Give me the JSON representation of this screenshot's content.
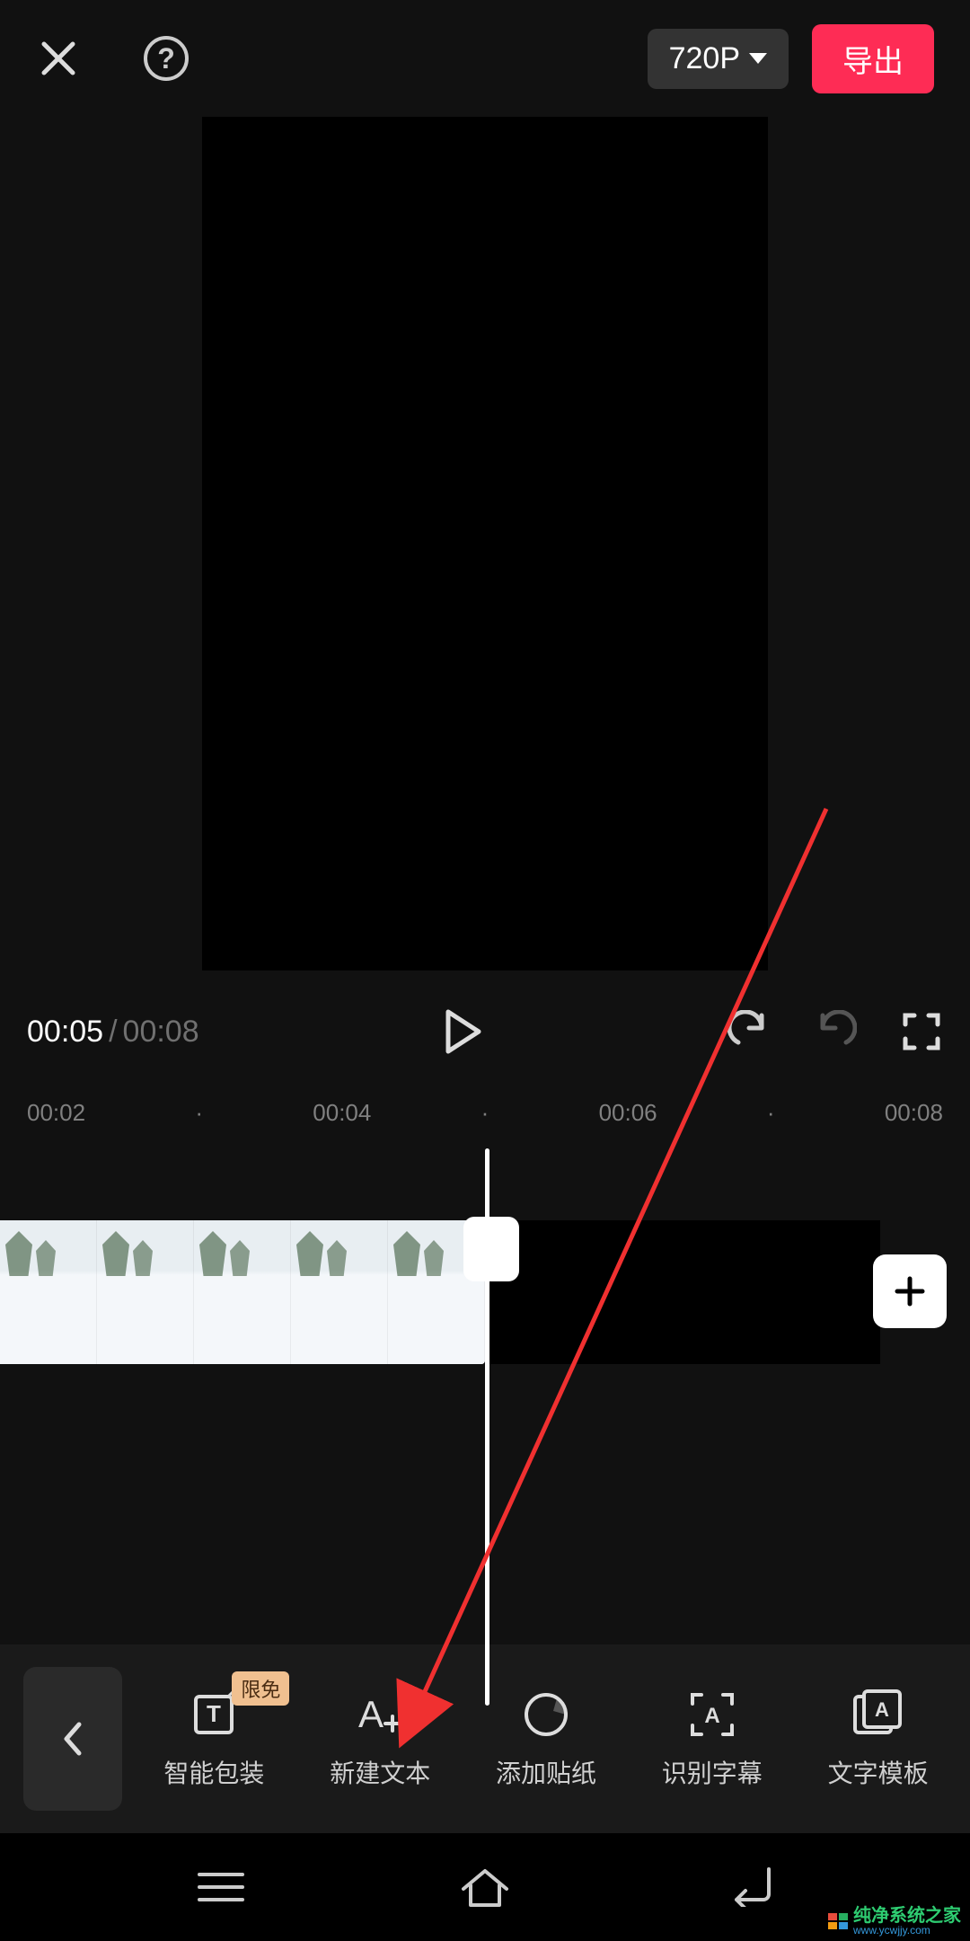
{
  "header": {
    "resolution": "720P",
    "export": "导出"
  },
  "playback": {
    "current": "00:05",
    "total": "00:08"
  },
  "ruler": [
    "00:02",
    "·",
    "00:04",
    "·",
    "00:06",
    "·",
    "00:08"
  ],
  "tools": {
    "back_exists": true,
    "items": [
      {
        "label": "智能包装",
        "badge": "限免",
        "icon": "smart-package"
      },
      {
        "label": "新建文本",
        "badge": null,
        "icon": "new-text"
      },
      {
        "label": "添加贴纸",
        "badge": null,
        "icon": "sticker"
      },
      {
        "label": "识别字幕",
        "badge": null,
        "icon": "recognize-subtitle"
      },
      {
        "label": "文字模板",
        "badge": null,
        "icon": "text-template"
      }
    ]
  },
  "watermark": {
    "line1": "纯净系统之家",
    "line2": "www.ycwjjy.com"
  }
}
